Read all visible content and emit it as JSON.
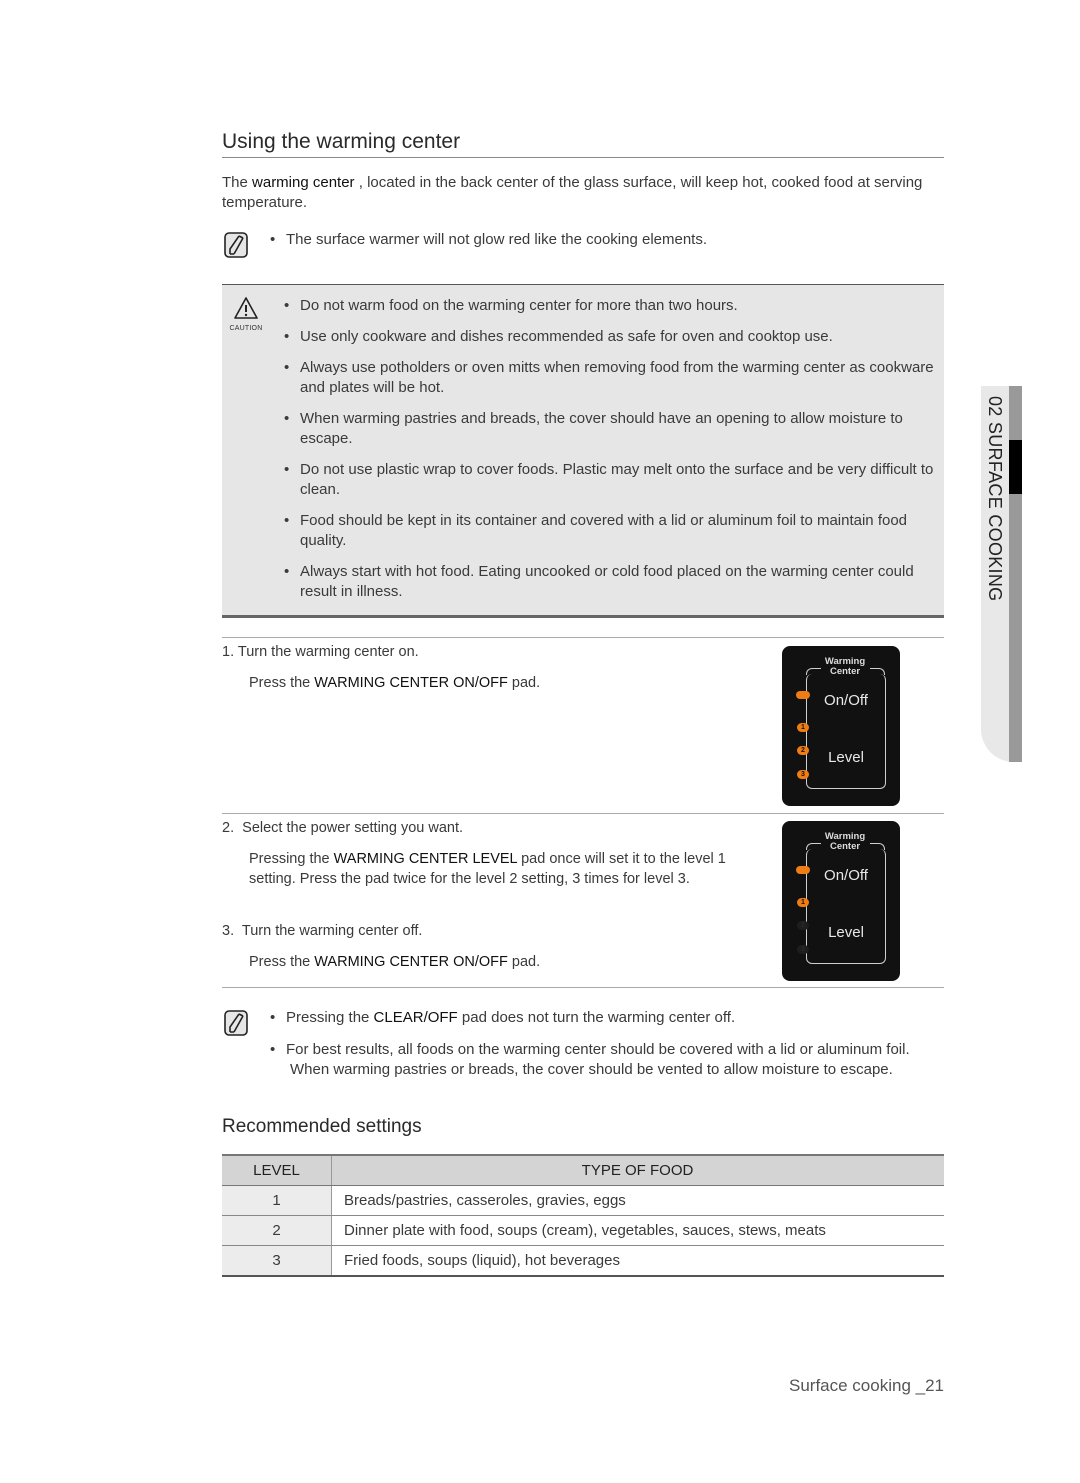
{
  "page": {
    "title": "Using the warming center",
    "intro": {
      "pre": "The ",
      "term": "warming center",
      "post": "  , located in the back center of the glass surface, will keep hot, cooked food at serving temperature."
    },
    "note1": {
      "icon": "note-pencil-icon",
      "items": [
        "The surface warmer will not glow red like the cooking elements."
      ]
    },
    "caution": {
      "icon": "warning-triangle-icon",
      "label": "CAUTION",
      "items": [
        "Do not warm food on the warming center for more than two hours.",
        "Use only cookware and dishes recommended as safe for oven and cooktop use.",
        "Always use potholders or oven mitts when removing food from the warming center as cookware and plates will be hot.",
        "When warming pastries and breads, the cover should have an opening to allow moisture to escape.",
        "Do not use plastic wrap to cover foods. Plastic may melt onto the surface and be very difficult to clean.",
        "Food should be kept in its container and covered with a lid or aluminum foil to maintain food quality.",
        "Always start with hot food. Eating uncooked or cold food placed on the warming center could result in illness."
      ]
    },
    "steps": [
      {
        "num": "1.",
        "heading": "Turn the warming center on.",
        "detail_pre": "Press the ",
        "detail_bold": "WARMING CENTER ON/OFF",
        "detail_post": "  pad."
      },
      {
        "num": "2.",
        "heading": "Select the power setting you want.",
        "detail_pre": "Pressing the ",
        "detail_bold": "WARMING CENTER LEVEL",
        "detail_post": "  pad once will set it to the level 1 setting. Press the pad twice for the level 2 setting, 3 times for level 3."
      },
      {
        "num": "3.",
        "heading": "Turn the warming center off.",
        "detail_pre": "Press the ",
        "detail_bold": "WARMING CENTER ON/OFF",
        "detail_post": "  pad."
      }
    ],
    "control_panel": {
      "label_line1": "Warming",
      "label_line2": "Center",
      "onoff": "On/Off",
      "level": "Level",
      "led_labels": [
        "1",
        "2",
        "3"
      ],
      "accent_color": "#f07c14",
      "panel1_active_levels": 3,
      "panel2_active_levels": 1
    },
    "note2": {
      "icon": "note-pencil-icon",
      "item1_pre": "Pressing the ",
      "item1_bold": "CLEAR/OFF",
      "item1_post": "  pad does not turn the warming center off.",
      "item2": "For best results, all foods on the warming center should be covered with a lid or aluminum foil. When warming pastries or breads, the cover should be vented to allow moisture to escape."
    },
    "recommended": {
      "title": "Recommended settings",
      "headers": [
        "LEVEL",
        "TYPE OF FOOD"
      ],
      "rows": [
        {
          "level": "1",
          "food": "Breads/pastries, casseroles, gravies, eggs"
        },
        {
          "level": "2",
          "food": "Dinner plate with food, soups (cream), vegetables, sauces, stews, meats"
        },
        {
          "level": "3",
          "food": "Fried foods, soups (liquid), hot beverages"
        }
      ]
    },
    "side_tab": "02  SURFACE COOKING",
    "footer": "Surface cooking _21"
  }
}
